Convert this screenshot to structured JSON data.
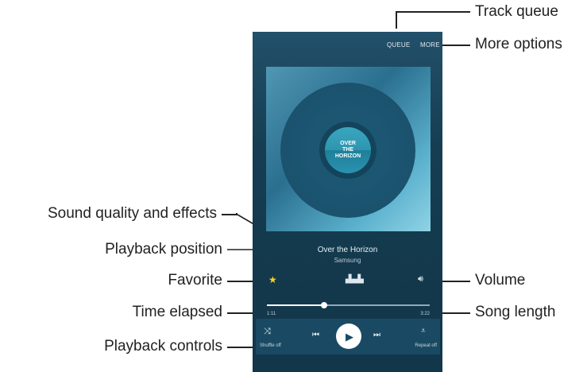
{
  "annotations": {
    "track_queue": "Track queue",
    "more_options": "More options",
    "sound_quality": "Sound quality and effects",
    "playback_position": "Playback position",
    "favorite": "Favorite",
    "volume": "Volume",
    "time_elapsed": "Time elapsed",
    "song_length": "Song length",
    "playback_controls": "Playback controls"
  },
  "player": {
    "queue_label": "QUEUE",
    "more_label": "MORE",
    "album_art_text": [
      "OVER",
      "THE",
      "HORIZON"
    ],
    "song_title": "Over the Horizon",
    "artist": "Samsung",
    "time_elapsed": "1:11",
    "song_length": "3:22",
    "progress_fraction": 0.35,
    "shuffle_label": "Shuffle off",
    "repeat_label": "Repeat off",
    "favorite_color": "#ffd21f"
  },
  "icons": {
    "favorite": "star-icon",
    "equalizer": "equalizer-icon",
    "volume": "volume-icon",
    "shuffle": "shuffle-icon",
    "previous": "previous-icon",
    "play": "play-icon",
    "next": "next-icon",
    "repeat": "repeat-icon"
  }
}
